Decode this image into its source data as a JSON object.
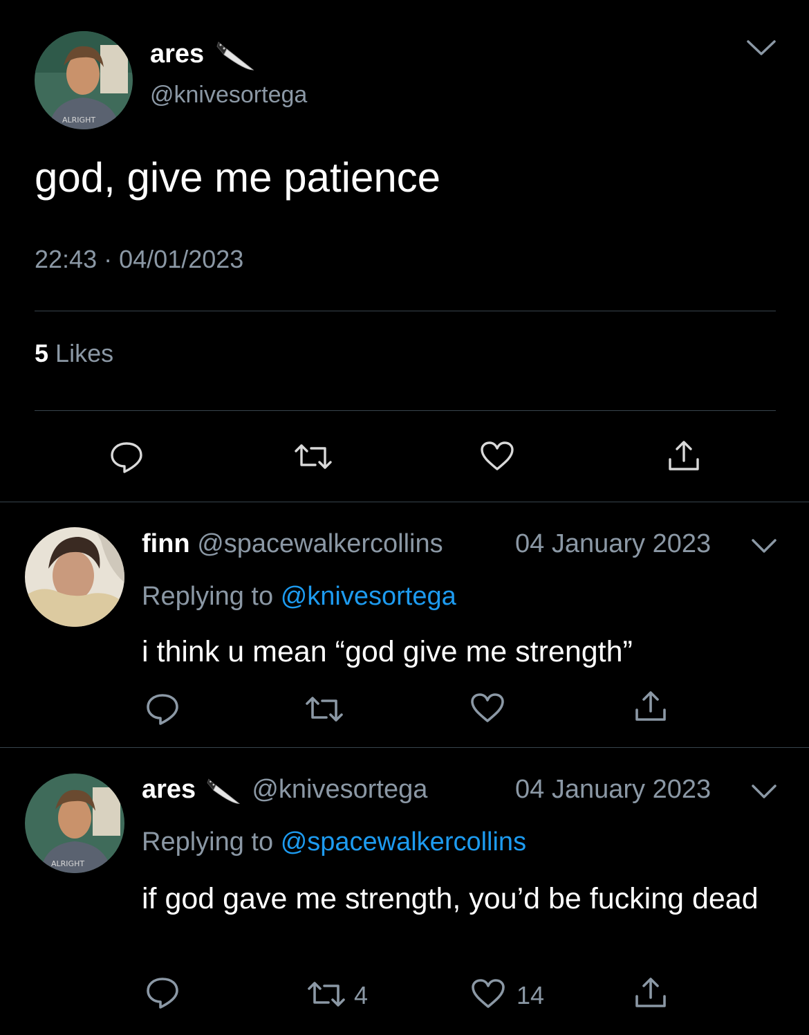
{
  "main_tweet": {
    "display_name": "ares",
    "emoji_icon": "knife-icon",
    "handle": "@knivesortega",
    "text": "god, give me patience",
    "time": "22:43",
    "separator": "·",
    "date": "04/01/2023",
    "likes_count": "5",
    "likes_label": "Likes"
  },
  "replies": [
    {
      "display_name": "finn",
      "handle": "@spacewalkercollins",
      "date": "04 January 2023",
      "replying_prefix": "Replying to",
      "replying_to": "@knivesortega",
      "text": "i think u mean “god give me strength”",
      "retweets": "",
      "likes": ""
    },
    {
      "display_name": "ares",
      "emoji_icon": "knife-icon",
      "handle": "@knivesortega",
      "date": "04 January 2023",
      "replying_prefix": "Replying to",
      "replying_to": "@spacewalkercollins",
      "text": "if god gave me strength, you’d be fucking dead",
      "retweets": "4",
      "likes": "14"
    }
  ],
  "colors": {
    "background": "#000000",
    "text": "#ffffff",
    "muted": "#8b98a5",
    "link": "#1d9bf0",
    "divider": "#38444d"
  }
}
